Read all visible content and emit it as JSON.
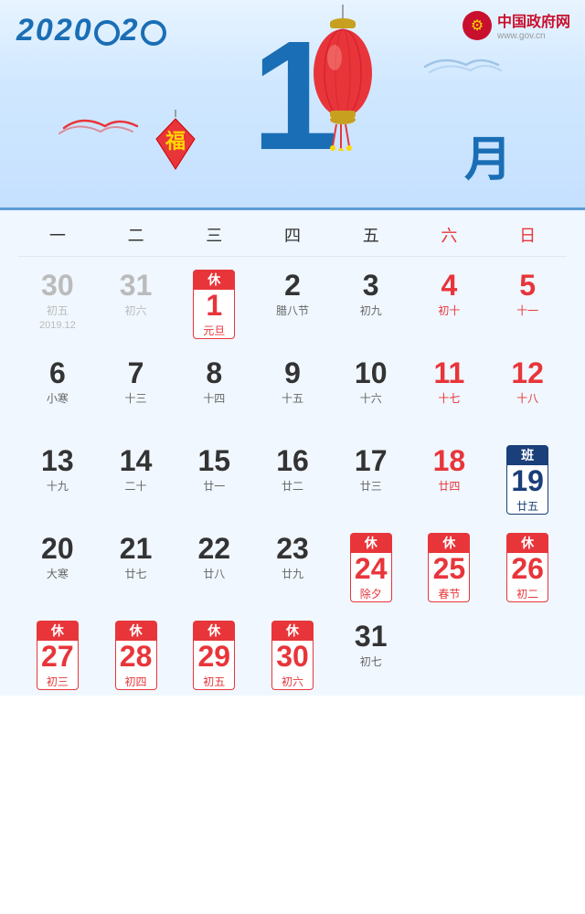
{
  "header": {
    "logo": "2020",
    "gov_name": "中国政府网",
    "gov_url": "www.gov.cn",
    "month_num": "1",
    "yue": "月"
  },
  "weekdays": [
    {
      "label": "一",
      "weekend": false
    },
    {
      "label": "二",
      "weekend": false
    },
    {
      "label": "三",
      "weekend": false
    },
    {
      "label": "四",
      "weekend": false
    },
    {
      "label": "五",
      "weekend": false
    },
    {
      "label": "六",
      "weekend": true
    },
    {
      "label": "日",
      "weekend": true
    }
  ],
  "rows": [
    {
      "cells": [
        {
          "day": "30",
          "lunar": "初五",
          "type": "prev",
          "year_label": "2019.12"
        },
        {
          "day": "31",
          "lunar": "初六",
          "type": "prev"
        },
        {
          "day": "1",
          "lunar": "元旦",
          "type": "current",
          "badge": "休",
          "badge_type": "holiday",
          "day_color": "red"
        },
        {
          "day": "2",
          "lunar": "腊八节",
          "type": "current"
        },
        {
          "day": "3",
          "lunar": "初九",
          "type": "current"
        },
        {
          "day": "4",
          "lunar": "初十",
          "type": "current",
          "day_color": "red"
        },
        {
          "day": "5",
          "lunar": "十一",
          "type": "current",
          "day_color": "red"
        }
      ]
    },
    {
      "cells": [
        {
          "day": "6",
          "lunar": "小寒",
          "type": "current"
        },
        {
          "day": "7",
          "lunar": "十三",
          "type": "current"
        },
        {
          "day": "8",
          "lunar": "十四",
          "type": "current"
        },
        {
          "day": "9",
          "lunar": "十五",
          "type": "current"
        },
        {
          "day": "10",
          "lunar": "十六",
          "type": "current"
        },
        {
          "day": "11",
          "lunar": "十七",
          "type": "current",
          "day_color": "red"
        },
        {
          "day": "12",
          "lunar": "十八",
          "type": "current",
          "day_color": "red"
        }
      ]
    },
    {
      "cells": [
        {
          "day": "13",
          "lunar": "十九",
          "type": "current"
        },
        {
          "day": "14",
          "lunar": "二十",
          "type": "current"
        },
        {
          "day": "15",
          "lunar": "廿一",
          "type": "current"
        },
        {
          "day": "16",
          "lunar": "廿二",
          "type": "current"
        },
        {
          "day": "17",
          "lunar": "廿三",
          "type": "current"
        },
        {
          "day": "18",
          "lunar": "廿四",
          "type": "current",
          "day_color": "red"
        },
        {
          "day": "19",
          "lunar": "廿五",
          "type": "current",
          "badge": "班",
          "badge_type": "workday",
          "day_color": "blue"
        }
      ]
    },
    {
      "cells": [
        {
          "day": "20",
          "lunar": "大寒",
          "type": "current"
        },
        {
          "day": "21",
          "lunar": "廿七",
          "type": "current"
        },
        {
          "day": "22",
          "lunar": "廿八",
          "type": "current"
        },
        {
          "day": "23",
          "lunar": "廿九",
          "type": "current"
        },
        {
          "day": "24",
          "lunar": "除夕",
          "type": "current",
          "badge": "休",
          "badge_type": "holiday",
          "day_color": "red"
        },
        {
          "day": "25",
          "lunar": "春节",
          "type": "current",
          "badge": "休",
          "badge_type": "holiday",
          "day_color": "red"
        },
        {
          "day": "26",
          "lunar": "初二",
          "type": "current",
          "badge": "休",
          "badge_type": "holiday",
          "day_color": "red"
        }
      ]
    },
    {
      "cells": [
        {
          "day": "27",
          "lunar": "初三",
          "type": "current",
          "badge": "休",
          "badge_type": "holiday",
          "day_color": "red"
        },
        {
          "day": "28",
          "lunar": "初四",
          "type": "current",
          "badge": "休",
          "badge_type": "holiday",
          "day_color": "red"
        },
        {
          "day": "29",
          "lunar": "初五",
          "type": "current",
          "badge": "休",
          "badge_type": "holiday",
          "day_color": "red"
        },
        {
          "day": "30",
          "lunar": "初六",
          "type": "current",
          "badge": "休",
          "badge_type": "holiday",
          "day_color": "red"
        },
        {
          "day": "31",
          "lunar": "初七",
          "type": "current"
        },
        {
          "day": "",
          "lunar": "",
          "type": "empty"
        },
        {
          "day": "",
          "lunar": "",
          "type": "empty"
        }
      ]
    }
  ]
}
